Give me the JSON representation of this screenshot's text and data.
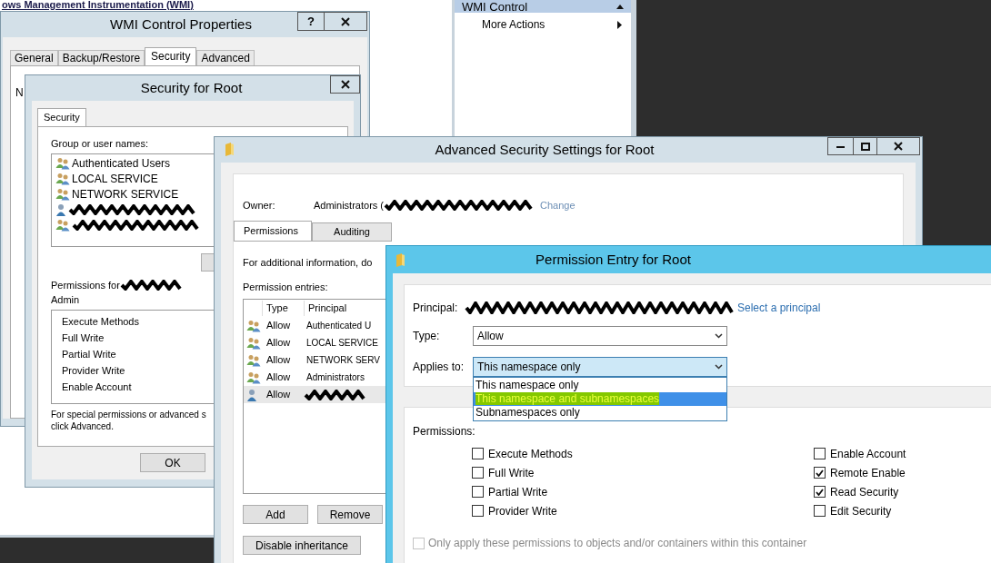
{
  "console": {
    "header": "ows Management Instrumentation (WMI)"
  },
  "actions_pane": {
    "header": "WMI Control",
    "items": [
      {
        "label": "More Actions"
      }
    ]
  },
  "wmi_properties": {
    "title": "WMI Control Properties",
    "help": "?",
    "tabs": [
      {
        "label": "General",
        "selected": false
      },
      {
        "label": "Backup/Restore",
        "selected": false
      },
      {
        "label": "Security",
        "selected": true
      },
      {
        "label": "Advanced",
        "selected": false
      }
    ],
    "content_text": "N"
  },
  "security_dialog": {
    "title": "Security for Root",
    "tabs": [
      {
        "label": "Security",
        "selected": true
      }
    ],
    "group_label": "Group or user names:",
    "principals": [
      {
        "kind": "group",
        "name": "Authenticated Users"
      },
      {
        "kind": "group",
        "name": "LOCAL SERVICE"
      },
      {
        "kind": "group",
        "name": "NETWORK SERVICE"
      },
      {
        "kind": "user"
      },
      {
        "kind": "group"
      }
    ],
    "permissions_label": "Permissions for",
    "permissions_label_2": "Admin",
    "permissions": [
      "Execute Methods",
      "Full Write",
      "Partial Write",
      "Provider Write",
      "Enable Account"
    ],
    "note_lines": [
      "For special permissions or advanced s",
      "click Advanced."
    ],
    "ok": "OK"
  },
  "advanced_dialog": {
    "title": "Advanced Security Settings for Root",
    "owner_label": "Owner:",
    "owner_value": "Administrators (",
    "change_link": "Change",
    "tabs": [
      {
        "label": "Permissions",
        "selected": true
      },
      {
        "label": "Auditing",
        "selected": false
      }
    ],
    "info": "For additional information, do",
    "entries_label": "Permission entries:",
    "columns": [
      "Type",
      "Principal"
    ],
    "rows": [
      {
        "kind": "group",
        "type": "Allow",
        "principal": "Authenticated U",
        "selected": false
      },
      {
        "kind": "group",
        "type": "Allow",
        "principal": "LOCAL SERVICE",
        "selected": false
      },
      {
        "kind": "group",
        "type": "Allow",
        "principal": "NETWORK SERV",
        "selected": false
      },
      {
        "kind": "group",
        "type": "Allow",
        "principal": "Administrators",
        "selected": false
      },
      {
        "kind": "user",
        "type": "Allow",
        "selected": true
      }
    ],
    "buttons": [
      "Add",
      "Remove"
    ],
    "disable_inheritance": "Disable inheritance"
  },
  "permission_entry": {
    "title": "Permission Entry for Root",
    "principal_label": "Principal:",
    "select_link": "Select a principal",
    "type_label": "Type:",
    "type_value": "Allow",
    "applies_label": "Applies to:",
    "applies_value": "This namespace only",
    "applies_expanded": true,
    "applies_options": [
      {
        "label": "This namespace only",
        "selected": false
      },
      {
        "label": "This namespace and subnamespaces",
        "selected": true
      },
      {
        "label": "Subnamespaces only",
        "selected": false
      }
    ],
    "permissions_label": "Permissions:",
    "permissions": [
      {
        "label": "Execute Methods",
        "checked": false
      },
      {
        "label": "Full Write",
        "checked": false
      },
      {
        "label": "Partial Write",
        "checked": false
      },
      {
        "label": "Provider Write",
        "checked": false
      },
      {
        "label": "Enable Account",
        "checked": false
      },
      {
        "label": "Remote Enable",
        "checked": true
      },
      {
        "label": "Read Security",
        "checked": true
      },
      {
        "label": "Edit Security",
        "checked": false
      }
    ],
    "only_apply": {
      "label": "Only apply these permissions to objects and/or containers within this container",
      "checked": false,
      "disabled": true
    }
  }
}
